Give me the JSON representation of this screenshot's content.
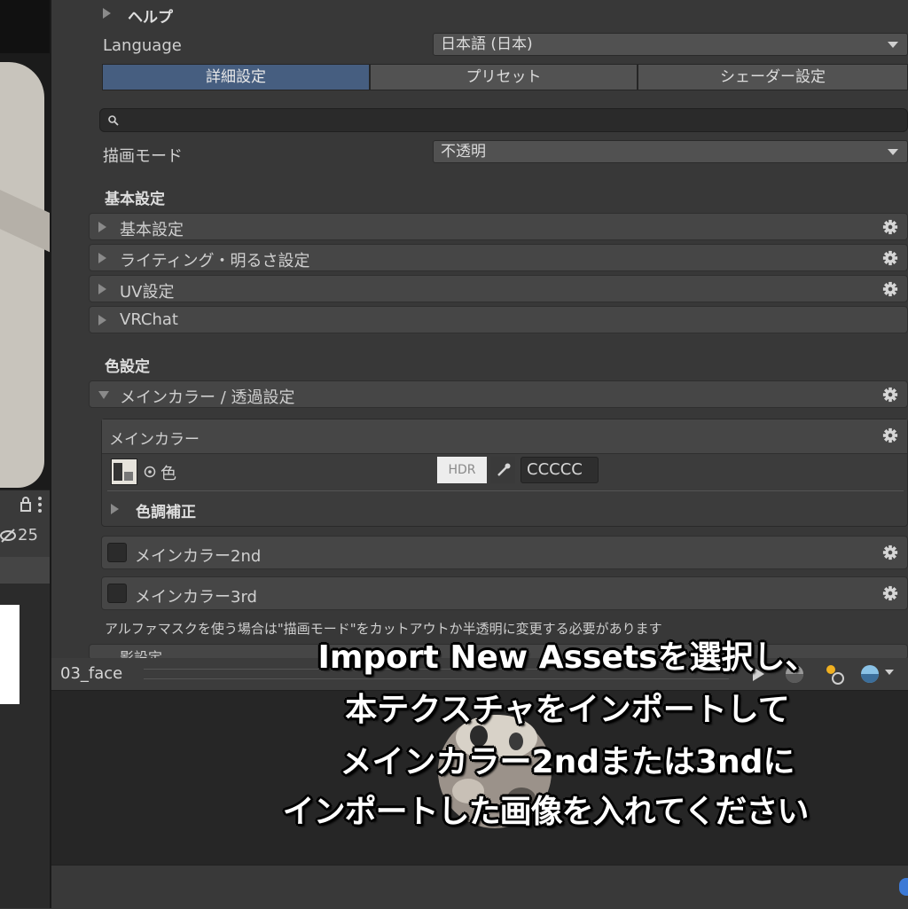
{
  "inspector": {
    "help_label": "ヘルプ",
    "language_label": "Language",
    "language_value": "日本語 (日本)",
    "tabs": [
      "詳細設定",
      "プリセット",
      "シェーダー設定"
    ],
    "render_mode_label": "描画モード",
    "render_mode_value": "不透明",
    "section_basic": "基本設定",
    "basic_folds": [
      "基本設定",
      "ライティング・明るさ設定",
      "UV設定",
      "VRChat"
    ],
    "section_color": "色設定",
    "main_color_fold": "メインカラー / 透過設定",
    "main_color_box_title": "メインカラー",
    "color_label": "色",
    "hdr_label": "HDR",
    "color_hex": "CCCCC",
    "tone_correction": "色調補正",
    "main_color_2nd": "メインカラー2nd",
    "main_color_3rd": "メインカラー3rd",
    "alpha_mask_note": "アルファマスクを使う場合は\"描画モード\"をカットアウトか半透明に変更する必要があります",
    "next_fold_partial": "影設定"
  },
  "left_panel": {
    "count": "25"
  },
  "preview": {
    "title": "03_face"
  },
  "overlay": {
    "lines": [
      "Import New Assetsを選択し、",
      "本テクスチャをインポートして",
      "メインカラー2ndまたは3ndに",
      "インポートした画像を入れてください"
    ]
  },
  "colors": {
    "accent_tab": "#465e80",
    "background": "#383838"
  }
}
